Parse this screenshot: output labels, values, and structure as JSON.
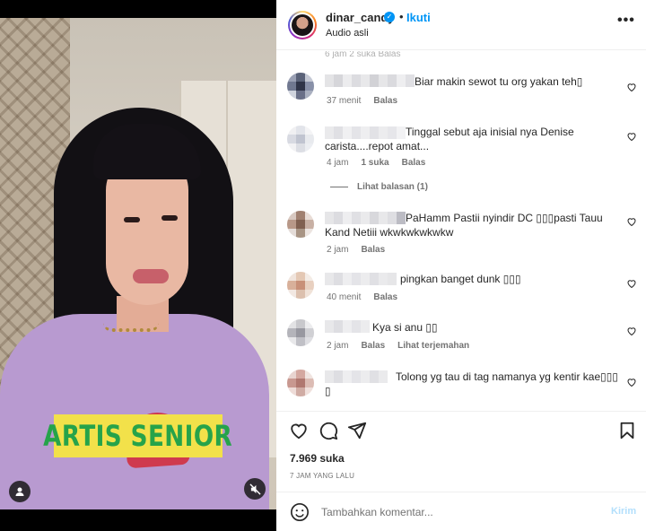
{
  "post": {
    "username": "dinar_candy",
    "follow_label": "Ikuti",
    "separator": "•",
    "audio": "Audio asli",
    "more_label": "•••",
    "verified_icon": "verified-badge-icon",
    "caption_overlay": "ARTIS SENIOR"
  },
  "comments": {
    "cut_meta": "6 jam  2 suka  Balas",
    "items": [
      {
        "text": "Biar makin sewot tu org yakan teh▯",
        "time": "37 menit",
        "likes": "",
        "reply": "Balas",
        "translate": ""
      },
      {
        "text": "Tinggal sebut aja inisial nya Denise carista....repot amat...",
        "time": "4 jam",
        "likes": "1 suka",
        "reply": "Balas",
        "translate": ""
      },
      {
        "text": "PaHamm Pastii nyindir DC ▯▯▯pasti Tauu Kand Netiii wkwkwkwkwkw",
        "time": "2 jam",
        "likes": "",
        "reply": "Balas",
        "translate": ""
      },
      {
        "text": "pingkan banget dunk ▯▯▯",
        "time": "40 menit",
        "likes": "",
        "reply": "Balas",
        "translate": ""
      },
      {
        "text": "Kya si anu ▯▯",
        "time": "2 jam",
        "likes": "",
        "reply": "Balas",
        "translate": "Lihat terjemahan"
      },
      {
        "text": "Tolong yg tau di tag namanya yg kentir kae▯▯▯ ▯",
        "time": "",
        "likes": "",
        "reply": "",
        "translate": ""
      }
    ],
    "view_replies": "Lihat balasan (1)"
  },
  "actions": {
    "likes": "7.969 suka",
    "time_ago": "7 JAM YANG LALU"
  },
  "add_comment": {
    "placeholder": "Tambahkan komentar...",
    "post_label": "Kirim"
  },
  "colors": {
    "link_blue": "#0095f6",
    "post_disabled": "#b2dffc",
    "caption_bg": "#f2e14a",
    "caption_text": "#26a34a"
  }
}
